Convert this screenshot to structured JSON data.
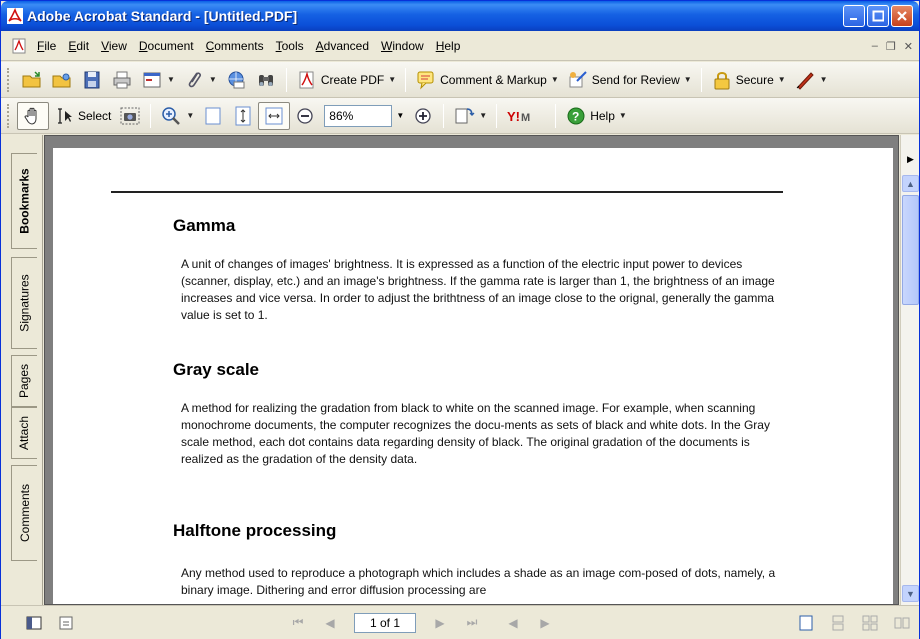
{
  "window": {
    "title": "Adobe Acrobat Standard - [Untitled.PDF]"
  },
  "menu": {
    "items": [
      "File",
      "Edit",
      "View",
      "Document",
      "Comments",
      "Tools",
      "Advanced",
      "Window",
      "Help"
    ]
  },
  "toolbar1": {
    "create_pdf": "Create PDF",
    "comment_markup": "Comment & Markup",
    "send_review": "Send for Review",
    "secure": "Secure"
  },
  "toolbar2": {
    "select": "Select",
    "zoom_value": "86%",
    "help": "Help"
  },
  "nav_tabs": [
    "Bookmarks",
    "Signatures",
    "Pages",
    "Attach",
    "Comments"
  ],
  "document": {
    "sections": [
      {
        "heading": "Gamma",
        "body": "A unit of changes of images' brightness. It is expressed as a function of the electric input power to devices (scanner, display, etc.) and an image's brightness. If the gamma rate is larger than 1, the brightness of an image increases and vice versa. In order to adjust the brithtness of an image close to the orignal, generally the gamma value is set to 1."
      },
      {
        "heading": "Gray scale",
        "body": "A method for realizing the gradation from black to white on the scanned image. For example, when scanning monochrome documents, the computer recognizes the docu-ments as sets of black and white dots. In the Gray scale method, each dot contains data regarding density of black. The original gradation of the documents is realized as the gradation of the density data."
      },
      {
        "heading": "Halftone processing",
        "body": "Any method used to reproduce a photograph which includes a shade as an image com-posed of dots, namely, a binary image. Dithering and error diffusion processing are"
      }
    ]
  },
  "statusbar": {
    "page_indicator": "1 of 1"
  },
  "colors": {
    "titlebar": "#0b4fd8",
    "accent_red": "#cc0000"
  }
}
